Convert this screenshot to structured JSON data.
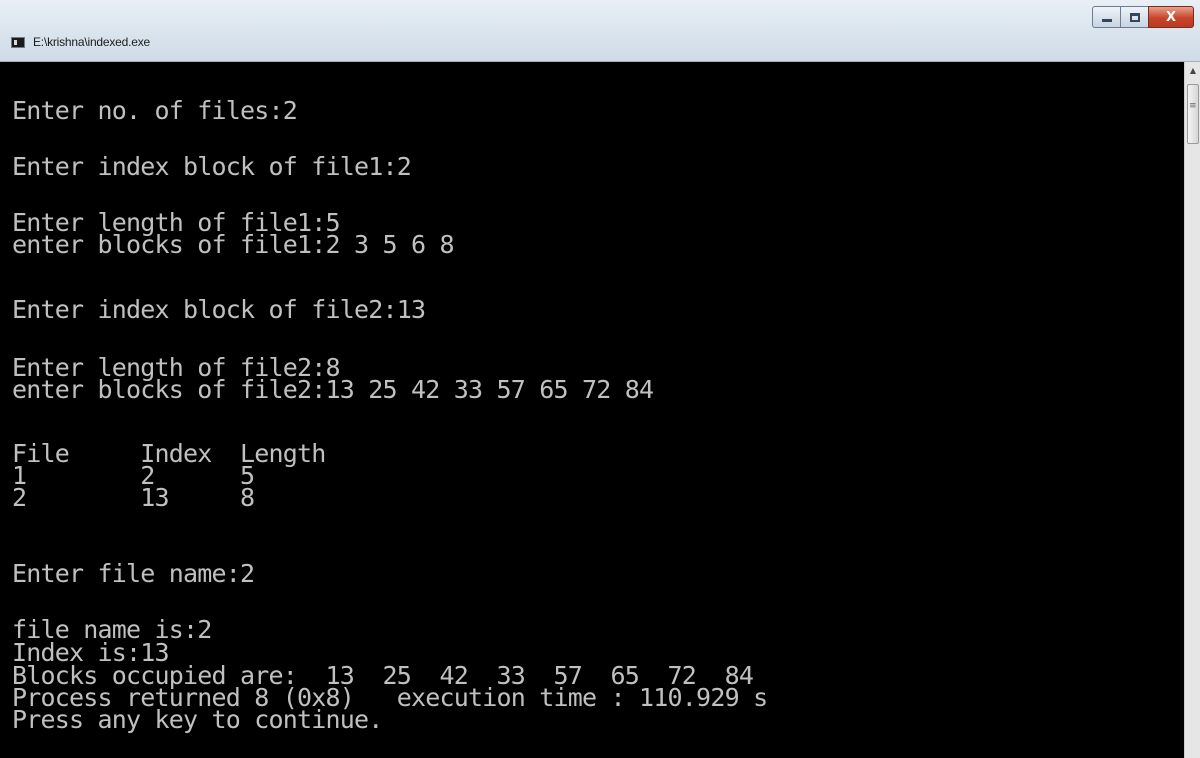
{
  "window": {
    "title": "E:\\krishna\\indexed.exe",
    "close_label": "X"
  },
  "console": {
    "lines": [
      "Enter no. of files:2",
      "Enter index block of file1:2",
      "Enter length of file1:5",
      "enter blocks of file1:2 3 5 6 8",
      "Enter index block of file2:13",
      "Enter length of file2:8",
      "enter blocks of file2:13 25 42 33 57 65 72 84",
      "File     Index  Length",
      "1        2      5",
      "2        13     8",
      "Enter file name:2",
      "file name is:2",
      "Index is:13",
      "Blocks occupied are:  13  25  42  33  57  65  72  84",
      "Process returned 8 (0x8)   execution time : 110.929 s",
      "Press any key to continue."
    ]
  }
}
